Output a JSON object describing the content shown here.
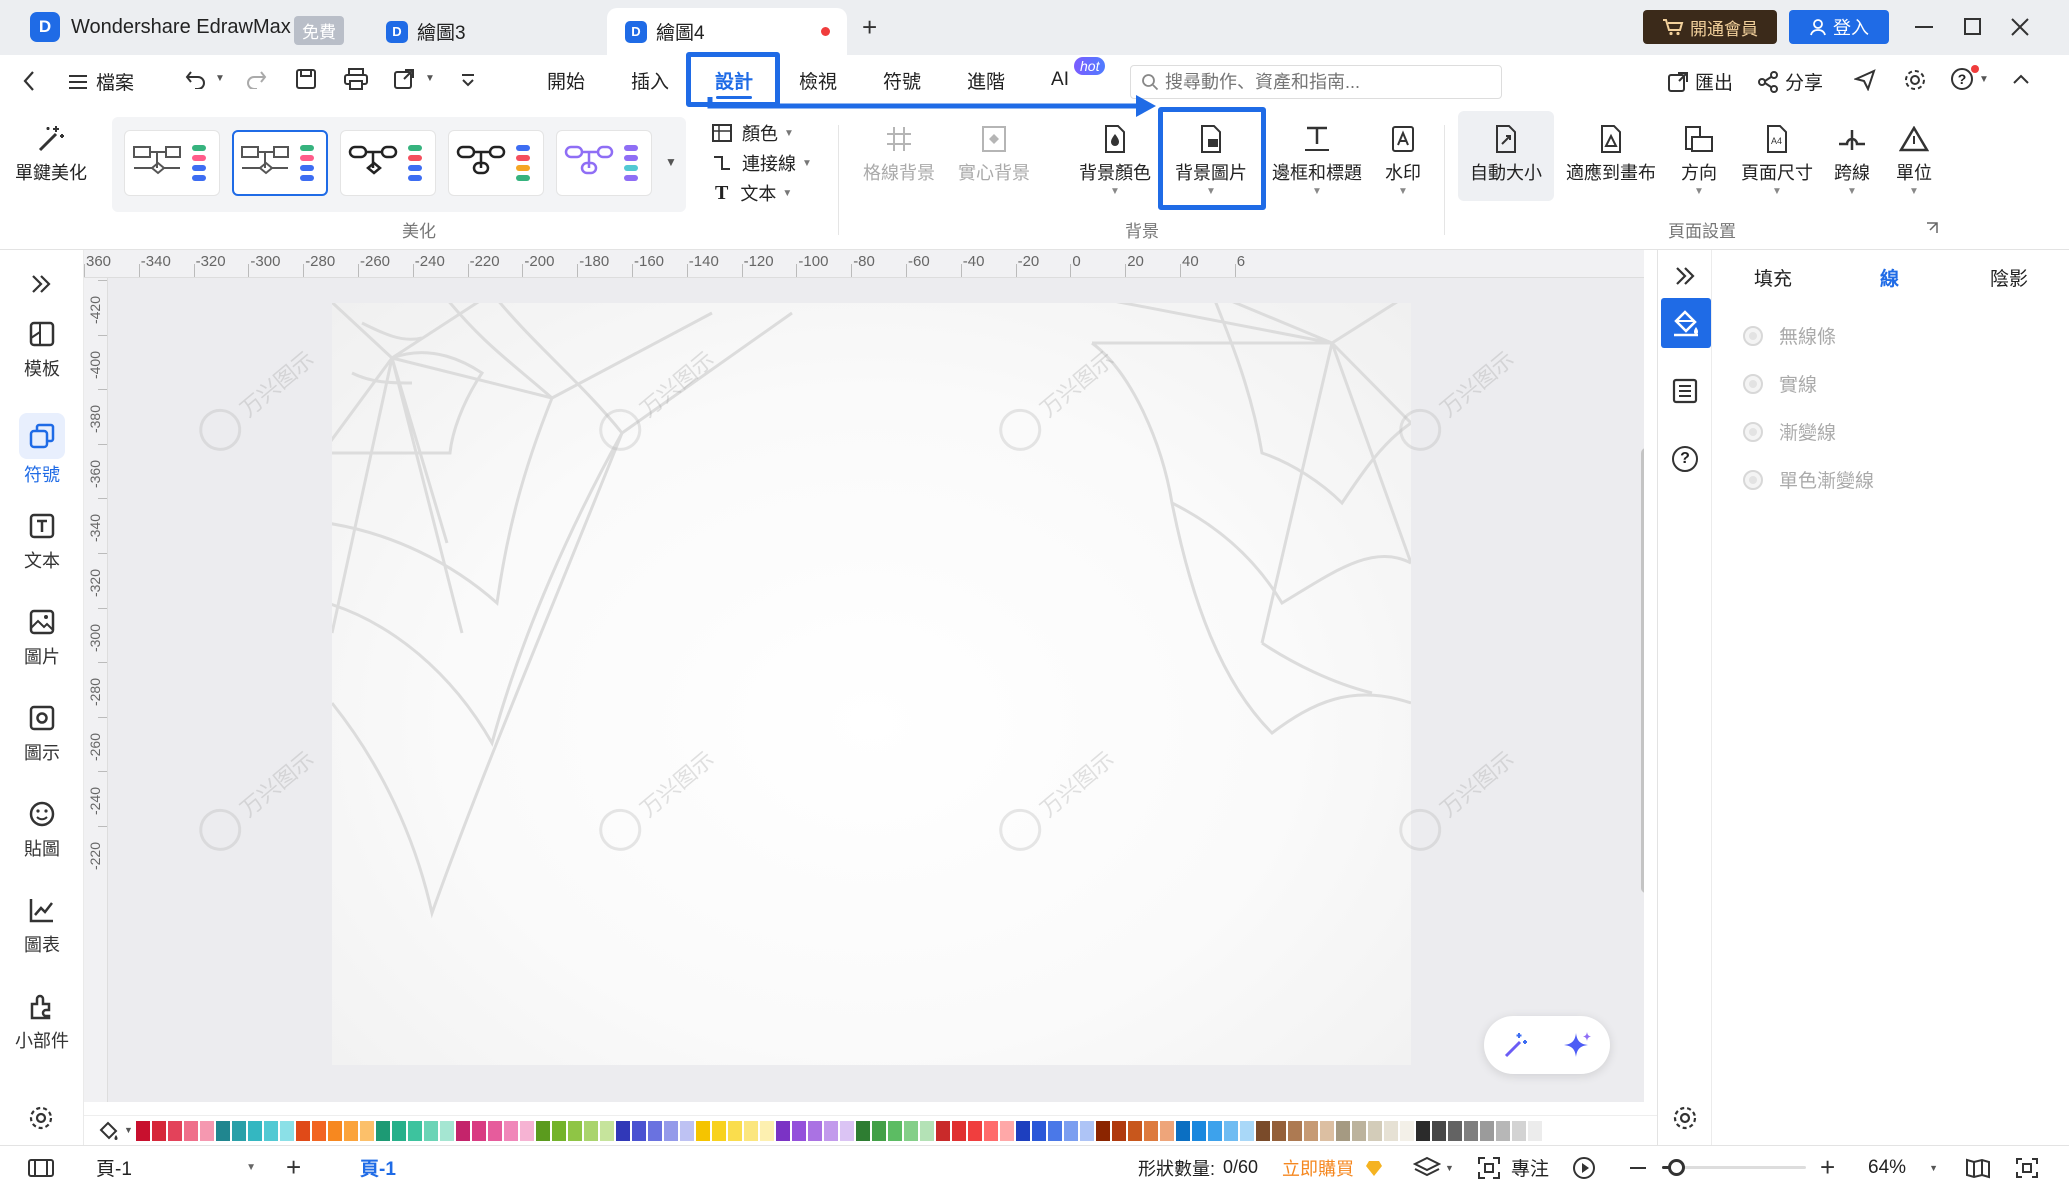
{
  "titlebar": {
    "app_name": "Wondershare EdrawMax",
    "badge": "免費",
    "tabs": [
      {
        "label": "繪圖3"
      },
      {
        "label": "繪圖4"
      }
    ],
    "vip_button": "開通會員",
    "login_button": "登入"
  },
  "toolbar": {
    "file_menu": "檔案",
    "menu_tabs": [
      "開始",
      "插入",
      "設計",
      "檢視",
      "符號",
      "進階",
      "AI"
    ],
    "ai_badge": "hot",
    "search_placeholder": "搜尋動作、資產和指南...",
    "export_label": "匯出",
    "share_label": "分享"
  },
  "ribbon": {
    "one_click": "單鍵美化",
    "beautify_group": "美化",
    "color_label": "顏色",
    "connector_label": "連接線",
    "text_label": "文本",
    "grid_bg": "格線背景",
    "solid_bg": "實心背景",
    "bg_color": "背景顏色",
    "bg_image": "背景圖片",
    "border_title": "邊框和標題",
    "watermark": "水印",
    "background_group": "背景",
    "auto_size": "自動大小",
    "fit_canvas": "適應到畫布",
    "orientation": "方向",
    "page_size": "頁面尺寸",
    "jump_line": "跨線",
    "unit": "單位",
    "page_setup_group": "頁面設置"
  },
  "left_sidebar": [
    {
      "label": "模板",
      "icon": "template-icon"
    },
    {
      "label": "符號",
      "icon": "symbol-icon"
    },
    {
      "label": "文本",
      "icon": "text-icon"
    },
    {
      "label": "圖片",
      "icon": "image-icon"
    },
    {
      "label": "圖示",
      "icon": "icon-library-icon"
    },
    {
      "label": "貼圖",
      "icon": "sticker-icon"
    },
    {
      "label": "圖表",
      "icon": "chart-icon"
    },
    {
      "label": "小部件",
      "icon": "widget-icon"
    }
  ],
  "ruler": {
    "top": [
      "360",
      "-340",
      "-320",
      "-300",
      "-280",
      "-260",
      "-240",
      "-220",
      "-200",
      "-180",
      "-160",
      "-140",
      "-120",
      "-100",
      "-80",
      "-60",
      "-40",
      "-20",
      "0",
      "20",
      "40",
      "6"
    ],
    "left": [
      "-420",
      "-400",
      "-380",
      "-360",
      "-340",
      "-320",
      "-300",
      "-280",
      "-260",
      "-240",
      "-220"
    ]
  },
  "watermark_text": "万兴图示",
  "right_panel": {
    "tabs": [
      "填充",
      "線",
      "陰影"
    ],
    "active_tab": "線",
    "options": [
      "無線條",
      "實線",
      "漸變線",
      "單色漸變線"
    ]
  },
  "palette": [
    "#c8102e",
    "#d6283a",
    "#e3425a",
    "#ef6f8a",
    "#f598b0",
    "#20868f",
    "#2aa0a8",
    "#34b7c1",
    "#52c9d3",
    "#8be0e7",
    "#e04a18",
    "#f26522",
    "#f7881f",
    "#fba33b",
    "#fcc06a",
    "#1d9a74",
    "#27b08a",
    "#3dc39e",
    "#6bd4b6",
    "#a5e6d2",
    "#c4246b",
    "#d93b82",
    "#e65c9c",
    "#f087b9",
    "#f6b3d3",
    "#5b9b1e",
    "#74b32b",
    "#8fc545",
    "#aad46d",
    "#c6e49c",
    "#3138b8",
    "#4a52d1",
    "#6a72e0",
    "#949aea",
    "#bec2f3",
    "#f5c400",
    "#f8d21e",
    "#fadd4d",
    "#fbe67e",
    "#fdf0b0",
    "#7b33c5",
    "#9450db",
    "#aa72e3",
    "#c29aec",
    "#dbc4f4",
    "#2e7d32",
    "#43a047",
    "#5cbc63",
    "#84cf89",
    "#b4e2b6",
    "#c92a2a",
    "#e03131",
    "#f03e3e",
    "#ff6b6b",
    "#ffa8a8",
    "#1d3fbf",
    "#2a58d8",
    "#4a78e8",
    "#7b9ef0",
    "#aec4f6",
    "#8b2500",
    "#b03a0e",
    "#c8571c",
    "#dd7a3e",
    "#eea57a",
    "#0b6fc2",
    "#1a88de",
    "#3da2ec",
    "#6fbcf2",
    "#a9d8f8",
    "#7a4b2a",
    "#94603a",
    "#ad7a52",
    "#c69a74",
    "#dcbfa2",
    "#a59a82",
    "#bcb39d",
    "#d3ccb9",
    "#e6e1d4",
    "#f3f0e8",
    "#2b2b2b",
    "#474747",
    "#636363",
    "#7f7f7f",
    "#9b9b9b",
    "#b7b7b7",
    "#d3d3d3",
    "#ececec"
  ],
  "statusbar": {
    "page_select": "頁-1",
    "page_tab": "頁-1",
    "shape_count_label": "形狀數量:",
    "shape_count": "0/60",
    "buy_now": "立即購買",
    "focus": "專注",
    "zoom": "64%",
    "zoom_level": 0.1
  }
}
